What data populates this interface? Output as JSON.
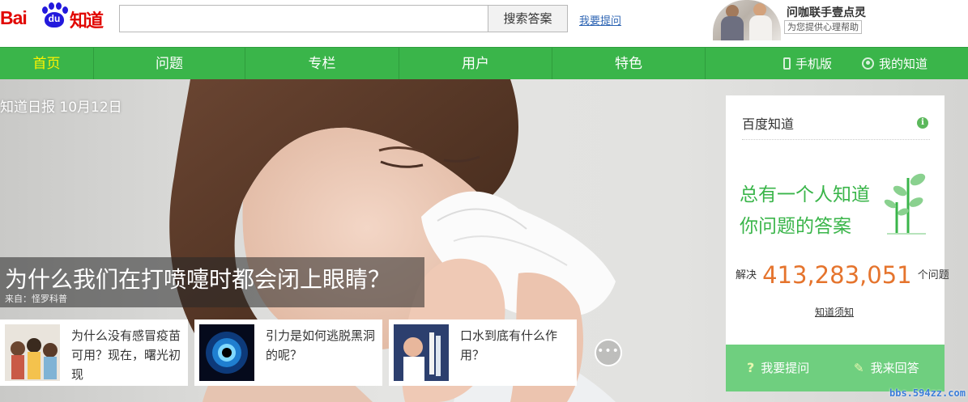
{
  "brand": {
    "bai": "Bai",
    "du": "du",
    "zhidao": "知道"
  },
  "search": {
    "value": "",
    "placeholder": "",
    "button_label": "搜索答案"
  },
  "header": {
    "ask_link": "我要提问"
  },
  "ad": {
    "title": "问咖联手壹点灵",
    "subtitle": "为您提供心理帮助"
  },
  "nav": {
    "items": [
      {
        "label": "首页",
        "active": true
      },
      {
        "label": "问题"
      },
      {
        "label": "专栏"
      },
      {
        "label": "用户"
      },
      {
        "label": "特色"
      }
    ],
    "mobile_label": "手机版",
    "my_label": "我的知道"
  },
  "hero": {
    "daily_label": "知道日报 10月12日",
    "headline": "为什么我们在打喷嚏时都会闭上眼睛？",
    "source": "来自：怪罗科普",
    "cards": [
      {
        "text": "为什么没有感冒疫苗可用？现在，曙光初现"
      },
      {
        "text": "引力是如何逃脱黑洞的呢？"
      },
      {
        "text": "口水到底有什么作用？"
      }
    ],
    "more_label": "•••"
  },
  "panel": {
    "title": "百度知道",
    "info_icon": "i",
    "slogan_line1": "总有一个人知道",
    "slogan_line2": "你问题的答案",
    "solved_prefix": "解决",
    "solved_count": "413,283,051",
    "solved_suffix": "个问题",
    "notice_link": "知道须知",
    "ask_button": "我要提问",
    "answer_button": "我来回答"
  },
  "watermark": "bbs.594zz.com",
  "colors": {
    "brand_red": "#e10601",
    "nav_green": "#3ab54a",
    "active_yellow": "#fff200",
    "count_orange": "#e5742d"
  },
  "icons": [
    "baidu-paw-icon",
    "phone-icon",
    "user-icon",
    "info-icon",
    "sprout-icon",
    "question-icon",
    "pen-icon",
    "more-icon"
  ]
}
